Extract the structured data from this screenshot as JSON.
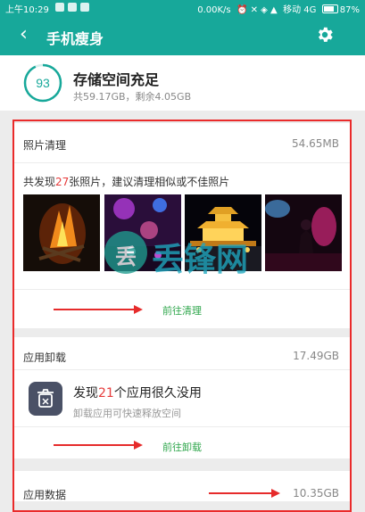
{
  "status_bar": {
    "time": "上午10:29",
    "net_speed": "0.00K/s",
    "carrier": "移动 4G",
    "battery": "87%"
  },
  "app_bar": {
    "title": "手机瘦身"
  },
  "summary": {
    "score": "93",
    "title": "存储空间充足",
    "detail": "共59.17GB，剩余4.05GB"
  },
  "photo_clean": {
    "title": "照片清理",
    "size": "54.65MB",
    "desc_prefix": "共发现",
    "count": "27",
    "desc_suffix": "张照片，建议清理相似或不佳照片",
    "thumbnails": [
      "campfire-photo",
      "stage-lights-photo",
      "lit-pagoda-photo",
      "concert-photo"
    ],
    "action": "前往清理"
  },
  "app_uninstall": {
    "title": "应用卸载",
    "size": "17.49GB",
    "headline_prefix": "发现",
    "count": "21",
    "headline_suffix": "个应用很久没用",
    "sub": "卸载应用可快速释放空间",
    "action": "前往卸载"
  },
  "app_data": {
    "title": "应用数据",
    "size": "10.35GB"
  },
  "watermark": {
    "text": "丢锋网",
    "badge": "丢"
  },
  "colors": {
    "primary": "#17a89a",
    "action": "#2ea64b",
    "highlight": "#e63a3a",
    "annotation": "#ea2b2b"
  }
}
